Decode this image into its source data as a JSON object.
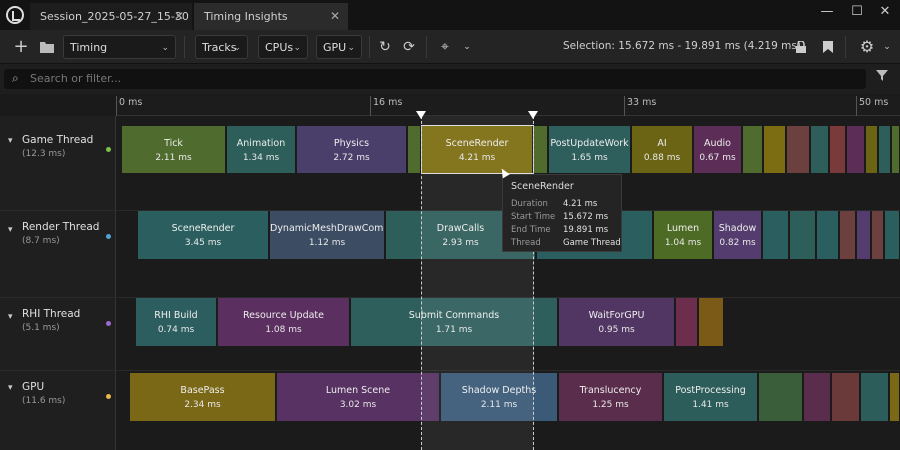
{
  "tabs": [
    {
      "label": "Session_2025-05-27_15-30",
      "close": "✕"
    },
    {
      "label": "Timing Insights",
      "close": "✕"
    }
  ],
  "window_buttons": [
    "—",
    "☐",
    "✕"
  ],
  "toolbar": {
    "view_label": "Timing",
    "tracks_label": "Tracks",
    "cpus_label": "CPUs",
    "gpu_label": "GPU",
    "selection_text": "Selection: 15.672 ms - 19.891 ms (4.219 ms)"
  },
  "search": {
    "placeholder": "Search or filter..."
  },
  "ruler": {
    "ticks": [
      "0 ms",
      "16 ms",
      "33 ms",
      "50 ms"
    ]
  },
  "threads": [
    {
      "name": "Game Thread",
      "duration": "(12.3 ms)",
      "color": "#7cc24a"
    },
    {
      "name": "Render Thread",
      "duration": "(8.7 ms)",
      "color": "#4fa3d6"
    },
    {
      "name": "RHI Thread",
      "duration": "(5.1 ms)",
      "color": "#9a6ad0"
    },
    {
      "name": "GPU",
      "duration": "(11.6 ms)",
      "color": "#e8b84a"
    }
  ],
  "events": {
    "game": [
      {
        "name": "Tick",
        "dur": "2.11 ms",
        "color": "#4f6b2e"
      },
      {
        "name": "Animation",
        "dur": "1.34 ms",
        "color": "#2d5e5a"
      },
      {
        "name": "Physics",
        "dur": "2.72 ms",
        "color": "#4a3f6a"
      },
      {
        "name": "SceneRender",
        "dur": "4.21 ms",
        "color": "#7d6d12"
      },
      {
        "name": "PostUpdateWork",
        "dur": "1.65 ms",
        "color": "#2f5f5d"
      },
      {
        "name": "AI",
        "dur": "0.88 ms",
        "color": "#6b6414"
      },
      {
        "name": "Audio",
        "dur": "0.67 ms",
        "color": "#5c2d57"
      }
    ],
    "render": [
      {
        "name": "SceneRender",
        "dur": "3.45 ms",
        "color": "#2b5f5f"
      },
      {
        "name": "DynamicMeshDrawCommand",
        "dur": "1.12 ms",
        "color": "#3c4c63"
      },
      {
        "name": "DrawCalls",
        "dur": "2.93 ms",
        "color": "#2e5e5a"
      },
      {
        "name": "Lumen",
        "dur": "1.04 ms",
        "color": "#4e6b25"
      },
      {
        "name": "Shadow",
        "dur": "0.82 ms",
        "color": "#553c6e"
      }
    ],
    "rhi": [
      {
        "name": "RHI Build",
        "dur": "0.74 ms",
        "color": "#2d5e5f"
      },
      {
        "name": "Resource Update",
        "dur": "1.08 ms",
        "color": "#5b2f5f"
      },
      {
        "name": "Submit Commands",
        "dur": "1.71 ms",
        "color": "#2f5f5d"
      },
      {
        "name": "WaitForGPU",
        "dur": "0.95 ms",
        "color": "#513563"
      }
    ],
    "gpu": [
      {
        "name": "BasePass",
        "dur": "2.34 ms",
        "color": "#7a6816"
      },
      {
        "name": "Lumen Scene",
        "dur": "3.02 ms",
        "color": "#573262"
      },
      {
        "name": "Shadow Depths",
        "dur": "2.11 ms",
        "color": "#3a5a78"
      },
      {
        "name": "Translucency",
        "dur": "1.25 ms",
        "color": "#5b2d4c"
      },
      {
        "name": "PostProcessing",
        "dur": "1.41 ms",
        "color": "#2c5d5a"
      }
    ]
  },
  "tooltip": {
    "title": "SceneRender",
    "duration_label": "Duration",
    "duration": "4.21 ms",
    "start_label": "Start Time",
    "start": "15.672 ms",
    "end_label": "End Time",
    "end": "19.891 ms",
    "thread_label": "Thread",
    "thread": "Game Thread"
  }
}
